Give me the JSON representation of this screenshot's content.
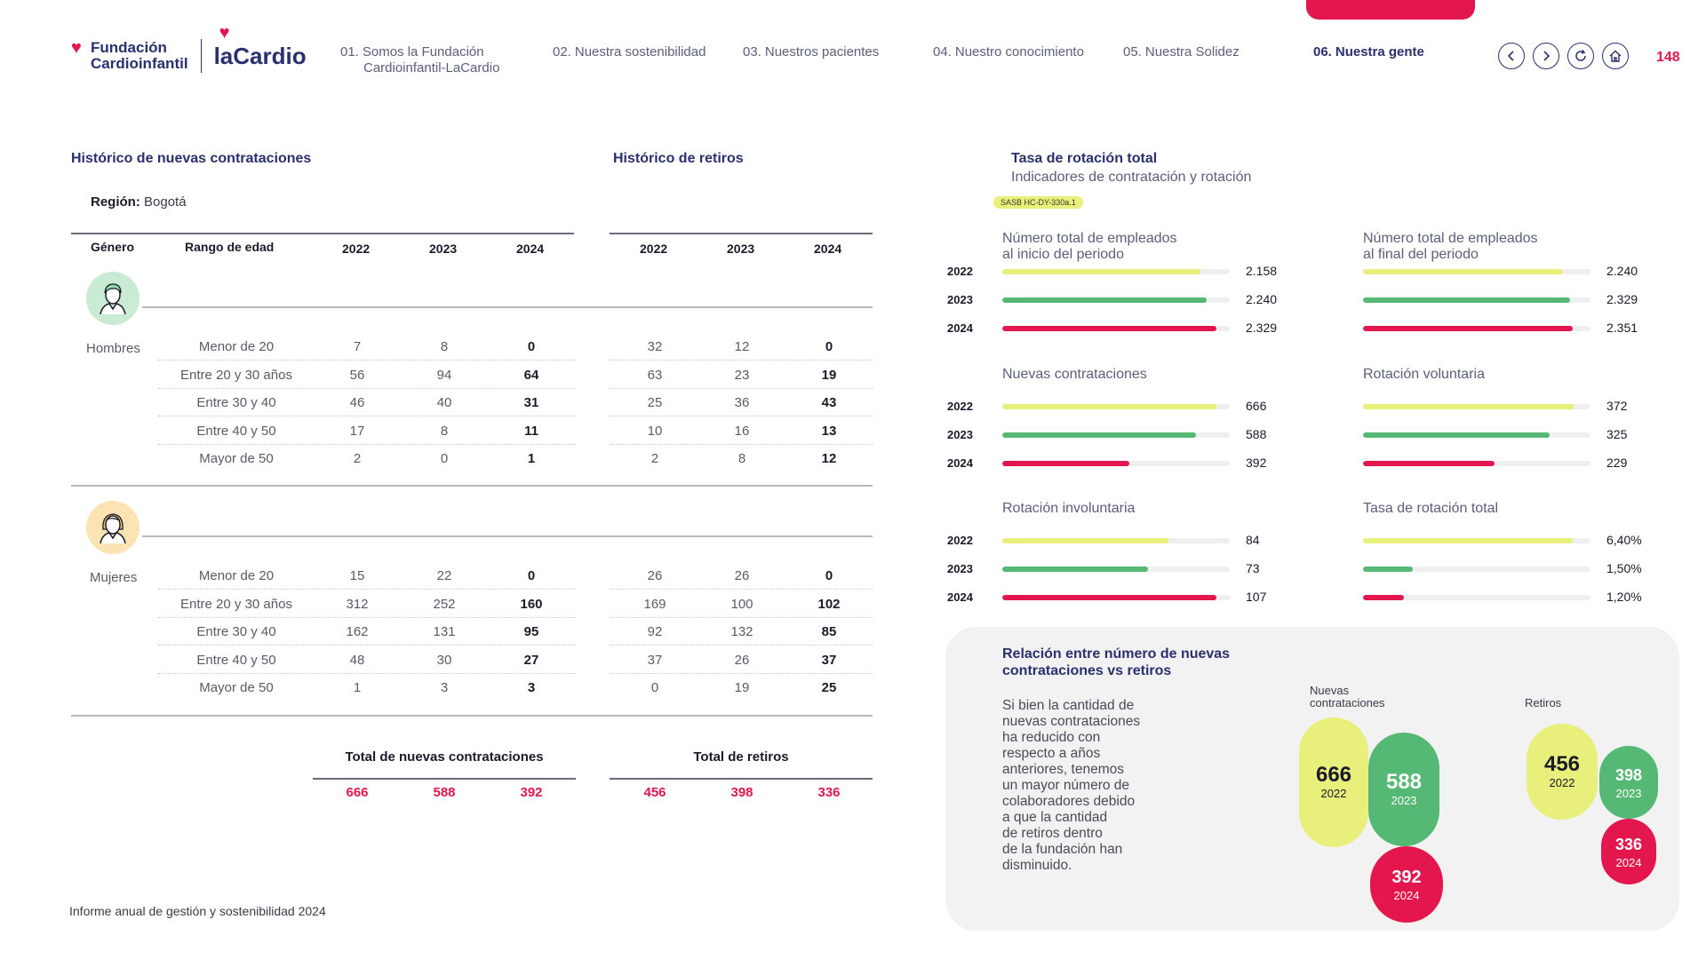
{
  "header": {
    "logo_left": [
      "Fundación",
      "Cardioinfantil"
    ],
    "logo_right": "laCardio",
    "nav": [
      {
        "num": "01.",
        "label": "Somos la Fundación",
        "label2": "Cardioinfantil-LaCardio"
      },
      {
        "num": "02.",
        "label": "Nuestra sostenibilidad"
      },
      {
        "num": "03.",
        "label": "Nuestros pacientes"
      },
      {
        "num": "04.",
        "label": "Nuestro conocimiento"
      },
      {
        "num": "05.",
        "label": "Nuestra Solidez"
      },
      {
        "num": "06.",
        "label": "Nuestra gente"
      }
    ],
    "icons": [
      "chevron-left-icon",
      "chevron-right-icon",
      "refresh-icon",
      "home-icon"
    ],
    "page_number": "148"
  },
  "tables": {
    "hires_title": "Histórico de nuevas contrataciones",
    "exits_title": "Histórico de retiros",
    "region_label": "Región:",
    "region_value": "Bogotá",
    "col_gender": "Género",
    "col_age": "Rango de edad",
    "years": [
      "2022",
      "2023",
      "2024"
    ],
    "men_label": "Hombres",
    "women_label": "Mujeres",
    "age_ranges": [
      "Menor de 20",
      "Entre 20 y 30 años",
      "Entre 30 y 40",
      "Entre 40 y 50",
      "Mayor de 50"
    ],
    "men_hires": [
      [
        "7",
        "8",
        "0"
      ],
      [
        "56",
        "94",
        "64"
      ],
      [
        "46",
        "40",
        "31"
      ],
      [
        "17",
        "8",
        "11"
      ],
      [
        "2",
        "0",
        "1"
      ]
    ],
    "men_exits": [
      [
        "32",
        "12",
        "0"
      ],
      [
        "63",
        "23",
        "19"
      ],
      [
        "25",
        "36",
        "43"
      ],
      [
        "10",
        "16",
        "13"
      ],
      [
        "2",
        "8",
        "12"
      ]
    ],
    "women_hires": [
      [
        "15",
        "22",
        "0"
      ],
      [
        "312",
        "252",
        "160"
      ],
      [
        "162",
        "131",
        "95"
      ],
      [
        "48",
        "30",
        "27"
      ],
      [
        "1",
        "3",
        "3"
      ]
    ],
    "women_exits": [
      [
        "26",
        "26",
        "0"
      ],
      [
        "169",
        "100",
        "102"
      ],
      [
        "92",
        "132",
        "85"
      ],
      [
        "37",
        "26",
        "37"
      ],
      [
        "0",
        "19",
        "25"
      ]
    ],
    "total_hires_label": "Total de nuevas contrataciones",
    "total_exits_label": "Total de retiros",
    "total_hires": [
      "666",
      "588",
      "392"
    ],
    "total_exits": [
      "456",
      "398",
      "336"
    ]
  },
  "rotation": {
    "title": "Tasa de rotación total",
    "subtitle": "Indicadores de contratación y rotación",
    "sasb_tag": "SASB HC-DY-330a.1",
    "colors": {
      "y2022": "#e8ef7a",
      "y2023": "#55b874",
      "y2024": "#e3174d",
      "track": "#efefef"
    },
    "indicators": [
      {
        "label": [
          "Número total de empleados",
          "al inicio del periodo"
        ],
        "years": [
          "2022",
          "2023",
          "2024"
        ],
        "values": [
          "2.158",
          "2.240",
          "2.329"
        ],
        "fill": [
          0.87,
          0.9,
          0.94
        ]
      },
      {
        "label": [
          "Número total de empleados",
          "al final del periodo"
        ],
        "years": [
          "2022",
          "2023",
          "2024"
        ],
        "values": [
          "2.240",
          "2.329",
          "2.351"
        ],
        "fill": [
          0.88,
          0.91,
          0.92
        ]
      },
      {
        "label": [
          "Nuevas contrataciones"
        ],
        "years": [
          "2022",
          "2023",
          "2024"
        ],
        "values": [
          "666",
          "588",
          "392"
        ],
        "fill": [
          0.94,
          0.85,
          0.56
        ]
      },
      {
        "label": [
          "Rotación voluntaria"
        ],
        "years": [
          "2022",
          "2023",
          "2024"
        ],
        "values": [
          "372",
          "325",
          "229"
        ],
        "fill": [
          0.93,
          0.82,
          0.58
        ]
      },
      {
        "label": [
          "Rotación involuntaria"
        ],
        "years": [
          "2022",
          "2023",
          "2024"
        ],
        "values": [
          "84",
          "73",
          "107"
        ],
        "fill": [
          0.73,
          0.64,
          0.94
        ]
      },
      {
        "label": [
          "Tasa de rotación total"
        ],
        "years": [
          "2022",
          "2023",
          "2024"
        ],
        "values": [
          "6,40%",
          "1,50%",
          "1,20%"
        ],
        "fill": [
          0.92,
          0.22,
          0.18
        ]
      }
    ]
  },
  "relation": {
    "title": "Relación entre número de nuevas contrataciones vs retiros",
    "text": [
      "Si bien la cantidad de",
      "nuevas contrataciones",
      "ha reducido con",
      "respecto a años",
      "anteriores, tenemos",
      "un mayor número de",
      "colaboradores debido",
      "a que la cantidad",
      "de retiros dentro",
      "de la fundación han",
      "disminuido."
    ],
    "hires_head": [
      "Nuevas",
      "contrataciones"
    ],
    "exits_head": "Retiros",
    "hires": [
      {
        "value": "666",
        "year": "2022"
      },
      {
        "value": "588",
        "year": "2023"
      },
      {
        "value": "392",
        "year": "2024"
      }
    ],
    "exits": [
      {
        "value": "456",
        "year": "2022"
      },
      {
        "value": "398",
        "year": "2023"
      },
      {
        "value": "336",
        "year": "2024"
      }
    ]
  },
  "footer": "Informe anual de gestión y sostenibilidad 2024"
}
